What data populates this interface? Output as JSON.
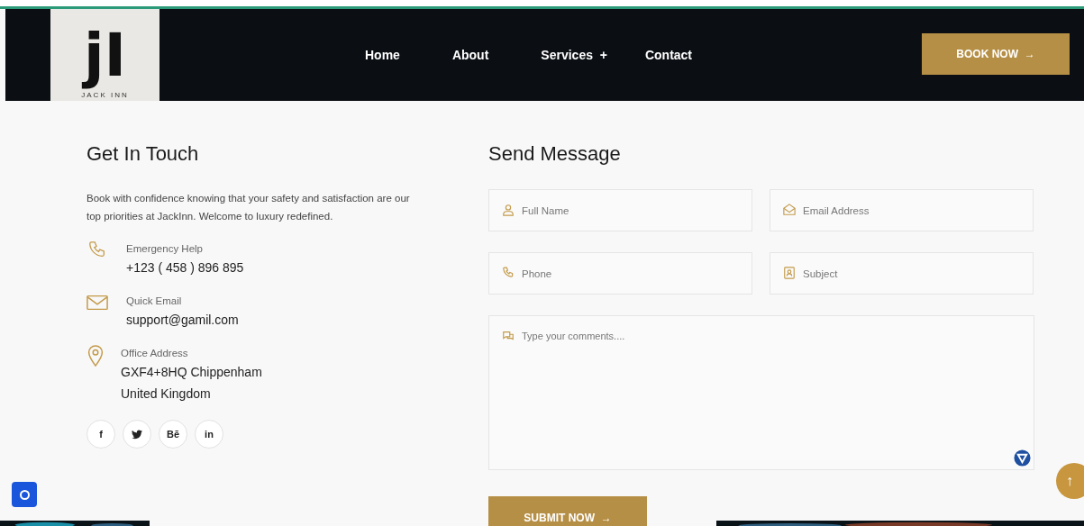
{
  "header": {
    "logo": {
      "monogram": "jI",
      "name": "JACK INN"
    },
    "nav": [
      {
        "label": "Home"
      },
      {
        "label": "About"
      },
      {
        "label": "Services",
        "submenu_mark": "+"
      },
      {
        "label": "Contact"
      }
    ],
    "cta": {
      "label": "BOOK NOW",
      "arrow": "→"
    }
  },
  "contact": {
    "title": "Get In Touch",
    "intro": "Book with confidence knowing that your safety and satisfaction are our top priorities at JackInn. Welcome to luxury redefined.",
    "items": [
      {
        "kind": "phone",
        "label": "Emergency Help",
        "lines": [
          "+123 ( 458 ) 896 895"
        ]
      },
      {
        "kind": "email",
        "label": "Quick Email",
        "lines": [
          "support@gamil.com"
        ]
      },
      {
        "kind": "location",
        "label": "Office Address",
        "lines": [
          "GXF4+8HQ Chippenham",
          "United Kingdom"
        ]
      }
    ],
    "social": [
      {
        "kind": "facebook",
        "label": "f"
      },
      {
        "kind": "twitter"
      },
      {
        "kind": "behance",
        "label": "Bē"
      },
      {
        "kind": "linkedin",
        "label": "in"
      }
    ]
  },
  "form": {
    "title": "Send Message",
    "fields": [
      {
        "kind": "person",
        "placeholder": "Full Name"
      },
      {
        "kind": "email",
        "placeholder": "Email Address"
      },
      {
        "kind": "phone",
        "placeholder": "Phone"
      },
      {
        "kind": "subject",
        "placeholder": "Subject"
      }
    ],
    "comments": {
      "placeholder": "Type your comments...."
    },
    "submit": {
      "label": "SUBMIT NOW",
      "arrow": "→"
    }
  },
  "scroll_top": {
    "label": "↑"
  }
}
